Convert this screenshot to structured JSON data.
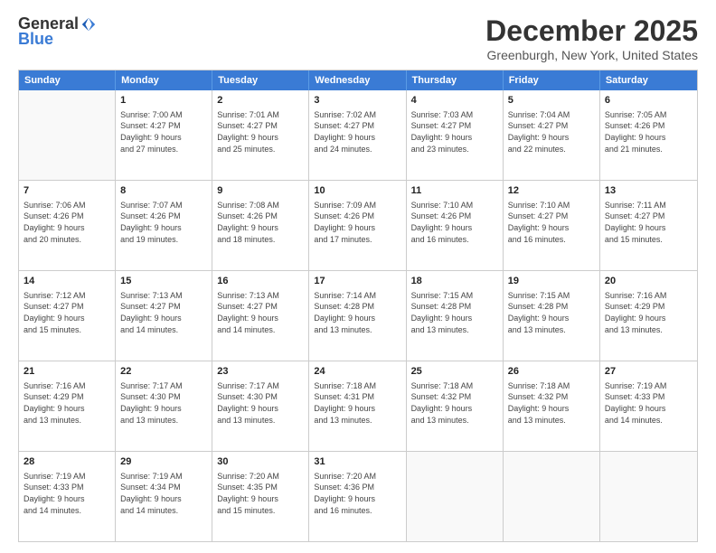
{
  "logo": {
    "general": "General",
    "blue": "Blue"
  },
  "title": "December 2025",
  "location": "Greenburgh, New York, United States",
  "header_days": [
    "Sunday",
    "Monday",
    "Tuesday",
    "Wednesday",
    "Thursday",
    "Friday",
    "Saturday"
  ],
  "weeks": [
    [
      {
        "day": "",
        "info": ""
      },
      {
        "day": "1",
        "info": "Sunrise: 7:00 AM\nSunset: 4:27 PM\nDaylight: 9 hours\nand 27 minutes."
      },
      {
        "day": "2",
        "info": "Sunrise: 7:01 AM\nSunset: 4:27 PM\nDaylight: 9 hours\nand 25 minutes."
      },
      {
        "day": "3",
        "info": "Sunrise: 7:02 AM\nSunset: 4:27 PM\nDaylight: 9 hours\nand 24 minutes."
      },
      {
        "day": "4",
        "info": "Sunrise: 7:03 AM\nSunset: 4:27 PM\nDaylight: 9 hours\nand 23 minutes."
      },
      {
        "day": "5",
        "info": "Sunrise: 7:04 AM\nSunset: 4:27 PM\nDaylight: 9 hours\nand 22 minutes."
      },
      {
        "day": "6",
        "info": "Sunrise: 7:05 AM\nSunset: 4:26 PM\nDaylight: 9 hours\nand 21 minutes."
      }
    ],
    [
      {
        "day": "7",
        "info": "Sunrise: 7:06 AM\nSunset: 4:26 PM\nDaylight: 9 hours\nand 20 minutes."
      },
      {
        "day": "8",
        "info": "Sunrise: 7:07 AM\nSunset: 4:26 PM\nDaylight: 9 hours\nand 19 minutes."
      },
      {
        "day": "9",
        "info": "Sunrise: 7:08 AM\nSunset: 4:26 PM\nDaylight: 9 hours\nand 18 minutes."
      },
      {
        "day": "10",
        "info": "Sunrise: 7:09 AM\nSunset: 4:26 PM\nDaylight: 9 hours\nand 17 minutes."
      },
      {
        "day": "11",
        "info": "Sunrise: 7:10 AM\nSunset: 4:26 PM\nDaylight: 9 hours\nand 16 minutes."
      },
      {
        "day": "12",
        "info": "Sunrise: 7:10 AM\nSunset: 4:27 PM\nDaylight: 9 hours\nand 16 minutes."
      },
      {
        "day": "13",
        "info": "Sunrise: 7:11 AM\nSunset: 4:27 PM\nDaylight: 9 hours\nand 15 minutes."
      }
    ],
    [
      {
        "day": "14",
        "info": "Sunrise: 7:12 AM\nSunset: 4:27 PM\nDaylight: 9 hours\nand 15 minutes."
      },
      {
        "day": "15",
        "info": "Sunrise: 7:13 AM\nSunset: 4:27 PM\nDaylight: 9 hours\nand 14 minutes."
      },
      {
        "day": "16",
        "info": "Sunrise: 7:13 AM\nSunset: 4:27 PM\nDaylight: 9 hours\nand 14 minutes."
      },
      {
        "day": "17",
        "info": "Sunrise: 7:14 AM\nSunset: 4:28 PM\nDaylight: 9 hours\nand 13 minutes."
      },
      {
        "day": "18",
        "info": "Sunrise: 7:15 AM\nSunset: 4:28 PM\nDaylight: 9 hours\nand 13 minutes."
      },
      {
        "day": "19",
        "info": "Sunrise: 7:15 AM\nSunset: 4:28 PM\nDaylight: 9 hours\nand 13 minutes."
      },
      {
        "day": "20",
        "info": "Sunrise: 7:16 AM\nSunset: 4:29 PM\nDaylight: 9 hours\nand 13 minutes."
      }
    ],
    [
      {
        "day": "21",
        "info": "Sunrise: 7:16 AM\nSunset: 4:29 PM\nDaylight: 9 hours\nand 13 minutes."
      },
      {
        "day": "22",
        "info": "Sunrise: 7:17 AM\nSunset: 4:30 PM\nDaylight: 9 hours\nand 13 minutes."
      },
      {
        "day": "23",
        "info": "Sunrise: 7:17 AM\nSunset: 4:30 PM\nDaylight: 9 hours\nand 13 minutes."
      },
      {
        "day": "24",
        "info": "Sunrise: 7:18 AM\nSunset: 4:31 PM\nDaylight: 9 hours\nand 13 minutes."
      },
      {
        "day": "25",
        "info": "Sunrise: 7:18 AM\nSunset: 4:32 PM\nDaylight: 9 hours\nand 13 minutes."
      },
      {
        "day": "26",
        "info": "Sunrise: 7:18 AM\nSunset: 4:32 PM\nDaylight: 9 hours\nand 13 minutes."
      },
      {
        "day": "27",
        "info": "Sunrise: 7:19 AM\nSunset: 4:33 PM\nDaylight: 9 hours\nand 14 minutes."
      }
    ],
    [
      {
        "day": "28",
        "info": "Sunrise: 7:19 AM\nSunset: 4:33 PM\nDaylight: 9 hours\nand 14 minutes."
      },
      {
        "day": "29",
        "info": "Sunrise: 7:19 AM\nSunset: 4:34 PM\nDaylight: 9 hours\nand 14 minutes."
      },
      {
        "day": "30",
        "info": "Sunrise: 7:20 AM\nSunset: 4:35 PM\nDaylight: 9 hours\nand 15 minutes."
      },
      {
        "day": "31",
        "info": "Sunrise: 7:20 AM\nSunset: 4:36 PM\nDaylight: 9 hours\nand 16 minutes."
      },
      {
        "day": "",
        "info": ""
      },
      {
        "day": "",
        "info": ""
      },
      {
        "day": "",
        "info": ""
      }
    ]
  ]
}
